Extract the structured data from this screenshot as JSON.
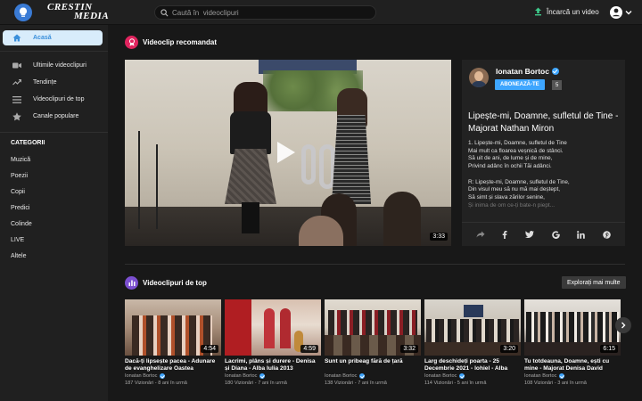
{
  "app": {
    "logo_line1": "CRESTIN",
    "logo_line2": "MEDIA"
  },
  "search": {
    "placeholder": "Caută în  videoclipuri"
  },
  "header": {
    "upload_label": "Încarcă un video"
  },
  "sidebar": {
    "items": [
      {
        "label": "Acasă",
        "icon": "home-icon",
        "active": true
      },
      {
        "label": "Ultimile videoclipuri",
        "icon": "video-camera-icon"
      },
      {
        "label": "Tendințe",
        "icon": "trending-icon"
      },
      {
        "label": "Videoclipuri de top",
        "icon": "top-list-icon"
      },
      {
        "label": "Canale populare",
        "icon": "star-icon"
      }
    ],
    "categories_heading": "CATEGORII",
    "categories": [
      "Muzică",
      "Poezii",
      "Copii",
      "Predici",
      "Colinde",
      "LIVE",
      "Altele"
    ]
  },
  "featured": {
    "section_title": "Videoclip recomandat",
    "duration": "3:33",
    "channel_name": "Ionatan Bortoc",
    "subscribe_label": "ABONEAZĂ-TE",
    "subscriber_count": "5",
    "video_title": "Lipește-mi, Doamne, sufletul de Tine - Majorat Nathan Miron",
    "lyrics": [
      "1. Lipește-mi, Doamne, sufletul de Tine",
      "Mai mult ca floarea veșnică de stânci.",
      "Să uit de ani, de lume și de mine,",
      "Privind adânc în ochii Tăi adânci.",
      "",
      "R: Lipește-mi, Doamne, sufletul de Tine,",
      "Din visul meu să nu mă mai deștept,",
      "Să simt și slava zărilor senine,",
      "Și inima de om ce-ți bate-n piept..."
    ],
    "share_icons": [
      "share-icon",
      "facebook-icon",
      "twitter-icon",
      "google-icon",
      "linkedin-icon",
      "pinterest-icon"
    ]
  },
  "top_videos": {
    "section_title": "Videoclipuri de top",
    "explore_label": "Explorați mai multe",
    "cards": [
      {
        "title": "Dacă-ți lipsește pacea - Adunare de evanghelizare Oastea Domnului",
        "channel": "Ionatan Bortoc",
        "meta": "187 Vizionări - 8 ani în urmă",
        "duration": "4:54"
      },
      {
        "title": "Lacrimi, plâns și durere - Denisa și Diana - Alba Iulia 2013",
        "channel": "Ionatan Bortoc",
        "meta": "180 Vizionări - 7 ani în urmă",
        "duration": "4:59"
      },
      {
        "title": "Sunt un pribeag fără de țară",
        "channel": "Ionatan Bortoc",
        "meta": "138 Vizionări - 7 ani în urmă",
        "duration": "3:32"
      },
      {
        "title": "Larg deschideți poarta - 25 Decembrie 2021 - Iohiel - Alba",
        "channel": "Ionatan Bortoc",
        "meta": "114 Vizionări - 5 ani în urmă",
        "duration": "3:20"
      },
      {
        "title": "Tu totdeauna, Doamne, ești cu mine - Majorat Denisa David",
        "channel": "Ionatan Bortoc",
        "meta": "108 Vizionări - 3 ani în urmă",
        "duration": "6:15"
      }
    ]
  }
}
